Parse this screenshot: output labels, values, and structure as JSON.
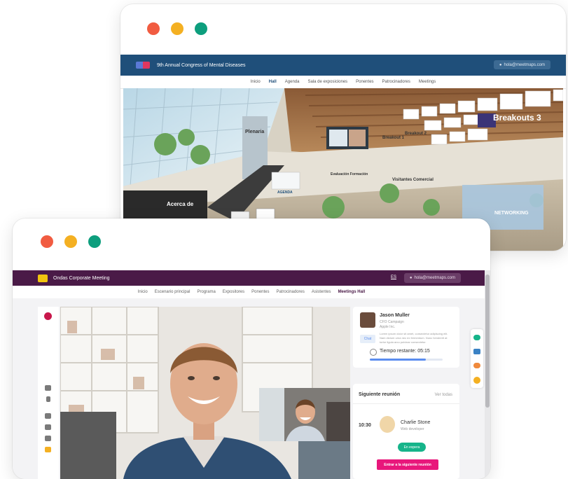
{
  "colors": {
    "dot_red": "#f15c41",
    "dot_yellow": "#f4b022",
    "dot_green": "#0d9e7d",
    "congress_bar": "#1f4f7a",
    "corporate_bar": "#4a1a47",
    "chat_green": "#16b48a",
    "cta_pink": "#e8177b",
    "progress_blue": "#5b8def"
  },
  "window1": {
    "title": "9th Annual Congress of Mental Diseases",
    "user_pill": "hola@meetmaps.com",
    "nav": [
      "Inicio",
      "Hall",
      "Agenda",
      "Sala de exposiciones",
      "Ponentes",
      "Patrocinadores",
      "Meetings"
    ],
    "active_nav": "Hall",
    "hall_signs": {
      "plenaria": "Plenaria",
      "breakouts_big": "Breakouts 3",
      "breakout_1": "Breakout 1",
      "breakout_2": "Breakout 2",
      "agenda": "AGENDA",
      "evaluacion": "Evaluación Formación",
      "visitantes": "Visitantes Comercial",
      "networking": "NETWORKING",
      "acerca": "Acerca de"
    }
  },
  "window2": {
    "title": "Ondas Corporate Meeting",
    "lang": "ES",
    "user_pill": "hola@meetmaps.com",
    "nav": [
      "Inicio",
      "Escenario principal",
      "Programa",
      "Expositores",
      "Ponentes",
      "Patrocinadores",
      "Asistentes",
      "Meetings Hall"
    ],
    "active_nav": "Meetings Hall",
    "participant": {
      "name": "Jason Muller",
      "role": "CFO Campaign",
      "company": "Apple Inc.",
      "bio": "Lorem ipsum dolor sit amet, consectetur adipiscing elit. Nam dictum urna nec ex fermentum. Nunc hendrerit at tortor ligula arcu pulvinar consectetur.",
      "chat_label": "Chat",
      "time_label": "Tiempo restante: 05:15",
      "progress": 0.77
    },
    "next_meeting": {
      "heading": "Siguiente reunión",
      "link": "Ver todas",
      "time": "10:30",
      "name": "Charlie Stone",
      "role": "Web developer",
      "status": "En espera",
      "cta": "Entrar a la siguiente reunión"
    },
    "icons": {
      "toolbar": [
        "camera-icon",
        "microphone-icon",
        "add-user-icon",
        "screen-share-icon",
        "grid-icon",
        "star-icon"
      ],
      "side": [
        "chat-icon",
        "message-icon",
        "hand-icon",
        "star-icon"
      ]
    }
  }
}
